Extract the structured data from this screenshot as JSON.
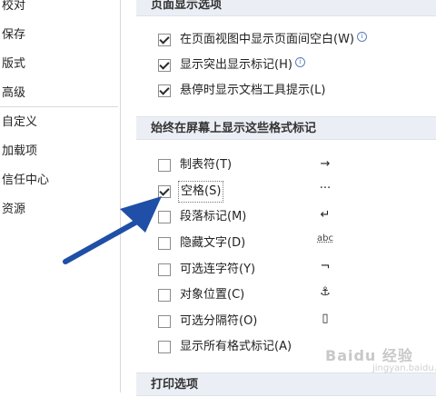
{
  "sidebar": {
    "items": [
      {
        "label": "校对"
      },
      {
        "label": "保存"
      },
      {
        "label": "版式"
      },
      {
        "label": "高级"
      },
      {
        "label": "自定义"
      },
      {
        "label": "加载项"
      },
      {
        "label": "信任中心"
      },
      {
        "label": "资源"
      }
    ]
  },
  "page_display": {
    "header": "页面显示选项",
    "options": [
      {
        "label": "在页面视图中显示页面间空白(W)",
        "checked": true,
        "info": true
      },
      {
        "label": "显示突出显示标记(H)",
        "checked": true,
        "info": true
      },
      {
        "label": "悬停时显示文档工具提示(L)",
        "checked": true,
        "info": false
      }
    ]
  },
  "format_marks": {
    "header": "始终在屏幕上显示这些格式标记",
    "options": [
      {
        "label": "制表符(T)",
        "checked": false,
        "symbol": "→"
      },
      {
        "label": "空格(S)",
        "checked": true,
        "symbol": "···"
      },
      {
        "label": "段落标记(M)",
        "checked": false,
        "symbol": "↵"
      },
      {
        "label": "隐藏文字(D)",
        "checked": false,
        "symbol": "abc"
      },
      {
        "label": "可选连字符(Y)",
        "checked": false,
        "symbol": "¬"
      },
      {
        "label": "对象位置(C)",
        "checked": false,
        "symbol": "⚓"
      },
      {
        "label": "可选分隔符(O)",
        "checked": false,
        "symbol": "▯"
      },
      {
        "label": "显示所有格式标记(A)",
        "checked": false,
        "symbol": ""
      }
    ]
  },
  "print": {
    "header": "打印选项"
  },
  "annotation": {
    "arrow_color": "#1f4fa6"
  },
  "watermark": {
    "text": "Baidu 经验",
    "sub": "jingyan.baidu.com"
  }
}
